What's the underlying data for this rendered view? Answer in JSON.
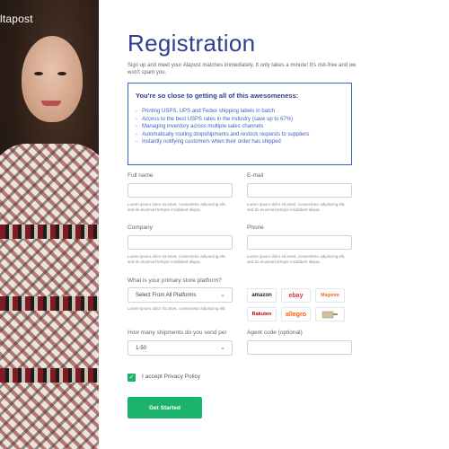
{
  "brand": {
    "logo_text": "ltapost"
  },
  "page": {
    "title": "Registration",
    "subtitle": "Sign up and meet your Alapost matches immediately. It only takes a minute! It's risk-free and we won't spam you."
  },
  "promo": {
    "heading": "You're so close to getting all of this awesomeness:",
    "items": [
      "Printing USPS, UPS and Fedex shipping labels in batch",
      "Access to the best USPS rates in the industry (save up to 67%)",
      "Managing inventory across multiple sales channels",
      "Automatically routing dropshipments and restock requests to suppliers",
      "Instantly notifying customers when their order has shipped"
    ]
  },
  "form": {
    "full_name": {
      "label": "Full name",
      "value": "",
      "help": "Lorem ipsum dolor sit amet, consectetur adipiscing elit, sed do eiusmod tempor incididunt aliqua."
    },
    "email": {
      "label": "E-mail",
      "value": "",
      "help": "Lorem ipsum dolor sit amet, consectetur adipiscing elit, sed do eiusmod tempor incididunt aliqua."
    },
    "company": {
      "label": "Company",
      "value": "",
      "help": "Lorem ipsum dolor sit amet, consectetur adipiscing elit, sed do eiusmod tempor incididunt aliqua."
    },
    "phone": {
      "label": "Phone",
      "value": "",
      "help": "Lorem ipsum dolor sit amet, consectetur adipiscing elit, sed do eiusmod tempor incididunt aliqua."
    },
    "platform": {
      "label": "What is your primary store platform?",
      "selected": "Select From All Platforms",
      "help": "Lorem ipsum dolor sit amet, consectetur adipiscing elit."
    },
    "shipments": {
      "label": "How many shipments do you send per",
      "selected": "1-50"
    },
    "agent_code": {
      "label": "Agent code (optional)",
      "value": ""
    },
    "privacy": {
      "label": "I accept Privacy Policy",
      "checked": true
    },
    "submit_label": "Get Started"
  },
  "platforms": [
    {
      "name": "amazon",
      "icon": "amazon-logo",
      "color": "#222222"
    },
    {
      "name": "ebay",
      "icon": "ebay-logo",
      "color": "#e53238"
    },
    {
      "name": "Magento",
      "icon": "magento-logo",
      "color": "#ee672f"
    },
    {
      "name": "Rakuten",
      "icon": "rakuten-logo",
      "color": "#bf0000"
    },
    {
      "name": "allegro",
      "icon": "allegro-logo",
      "color": "#ff5a00"
    },
    {
      "name": "",
      "icon": "shipping-box-logo",
      "color": "#b8a88a"
    }
  ],
  "colors": {
    "accent": "#1bb36b",
    "title": "#2f3f8f",
    "promo_border": "#3b63c4"
  }
}
